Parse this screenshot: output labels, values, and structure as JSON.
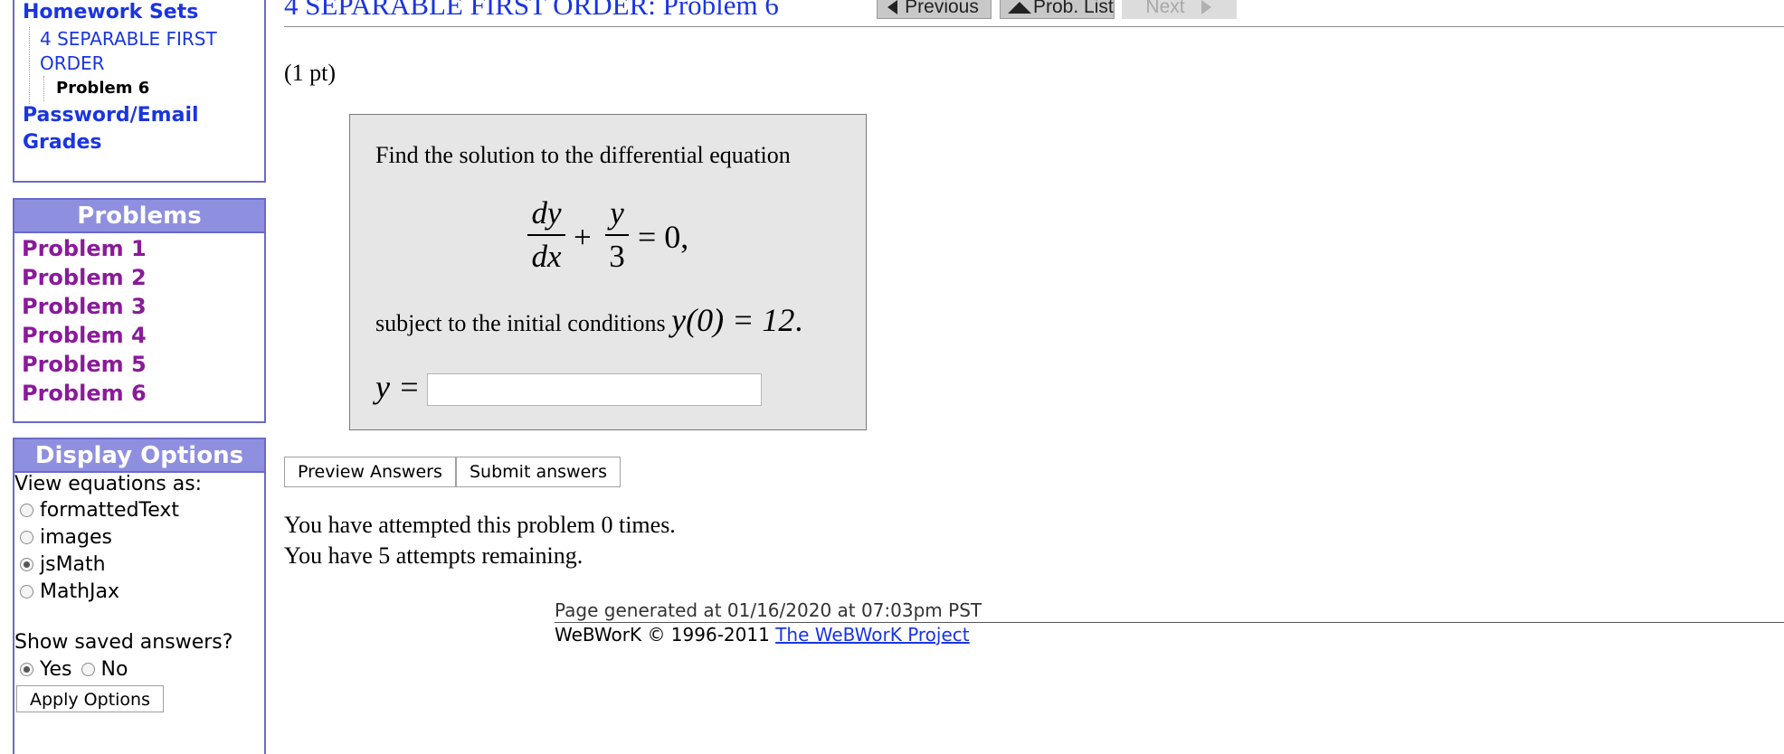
{
  "sidebar": {
    "nav": {
      "homework_sets": "Homework Sets",
      "set_name": "4 SEPARABLE FIRST ORDER",
      "current_problem": "Problem 6",
      "password_email": "Password/Email",
      "grades": "Grades"
    },
    "problems": {
      "header": "Problems",
      "items": [
        "Problem 1",
        "Problem 2",
        "Problem 3",
        "Problem 4",
        "Problem 5",
        "Problem 6"
      ]
    },
    "display_options": {
      "header": "Display Options",
      "view_label": "View equations as:",
      "modes": [
        {
          "label": "formattedText",
          "checked": false
        },
        {
          "label": "images",
          "checked": false
        },
        {
          "label": "jsMath",
          "checked": true
        },
        {
          "label": "MathJax",
          "checked": false
        }
      ],
      "show_saved_label": "Show saved answers?",
      "yes_label": "Yes",
      "no_label": "No",
      "yes_checked": true,
      "apply_label": "Apply Options"
    }
  },
  "header": {
    "title": "4 SEPARABLE FIRST ORDER: Problem 6",
    "previous_label": "Previous",
    "prob_list_label": "Prob. List",
    "next_label": "Next"
  },
  "problem": {
    "points": "(1 pt)",
    "intro": "Find the solution to the differential equation",
    "equation": {
      "frac1_num": "dy",
      "frac1_den": "dx",
      "plus": "+",
      "frac2_num": "y",
      "frac2_den": "3",
      "rest": "= 0,"
    },
    "condition_text": "subject to the initial conditions",
    "condition_math": "y(0) = 12",
    "condition_end": ".",
    "answer_label": "y =",
    "answer_value": ""
  },
  "buttons": {
    "preview": "Preview Answers",
    "submit": "Submit answers"
  },
  "attempts": {
    "line1": "You have attempted this problem 0 times.",
    "line2": "You have 5 attempts remaining."
  },
  "footer": {
    "generated": "Page generated at 01/16/2020 at 07:03pm PST",
    "copyright": "WeBWorK © 1996-2011",
    "project_link": "The WeBWorK Project"
  },
  "colors": {
    "link_blue": "#1a35e0",
    "problem_purple": "#8a1a9a",
    "box_header": "#8f8fe0",
    "box_border": "#6a6ac8",
    "problem_bg": "#e6e6e6"
  }
}
